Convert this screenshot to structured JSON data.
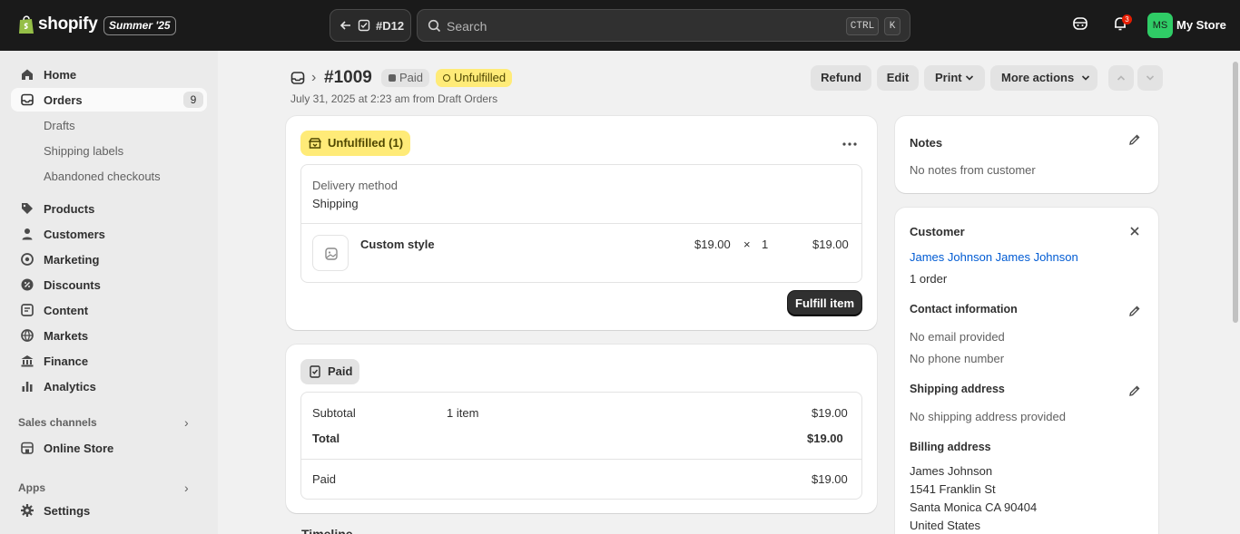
{
  "topbar": {
    "brand": "shopify",
    "edition": "Summer '25",
    "draft_tag": "#D12",
    "search_placeholder": "Search",
    "kbd_ctrl": "CTRL",
    "kbd_k": "K",
    "notification_count": "3",
    "avatar_initials": "MS",
    "store_name": "My Store"
  },
  "sidebar": {
    "home": "Home",
    "orders": "Orders",
    "orders_count": "9",
    "drafts": "Drafts",
    "shipping_labels": "Shipping labels",
    "abandoned": "Abandoned checkouts",
    "products": "Products",
    "customers": "Customers",
    "marketing": "Marketing",
    "discounts": "Discounts",
    "content": "Content",
    "markets": "Markets",
    "finance": "Finance",
    "analytics": "Analytics",
    "sales_channels": "Sales channels",
    "online_store": "Online Store",
    "apps": "Apps",
    "settings": "Settings"
  },
  "header": {
    "order_number": "#1009",
    "payment_badge": "Paid",
    "fulfillment_badge": "Unfulfilled",
    "subtitle": "July 31, 2025 at 2:23 am from Draft Orders",
    "refund": "Refund",
    "edit": "Edit",
    "print": "Print",
    "more_actions": "More actions"
  },
  "fulfillment_card": {
    "status": "Unfulfilled (1)",
    "delivery_label": "Delivery method",
    "delivery_value": "Shipping",
    "item_name": "Custom style",
    "item_price": "$19.00",
    "item_times": "×",
    "item_qty": "1",
    "item_total": "$19.00",
    "fulfill_button": "Fulfill item"
  },
  "payment_card": {
    "status": "Paid",
    "subtotal_label": "Subtotal",
    "subtotal_items": "1 item",
    "subtotal_value": "$19.00",
    "total_label": "Total",
    "total_value": "$19.00",
    "paid_label": "Paid",
    "paid_value": "$19.00",
    "timeline_partial": "Timeline"
  },
  "notes_card": {
    "title": "Notes",
    "text": "No notes from customer"
  },
  "customer_card": {
    "title": "Customer",
    "name": "James Johnson James Johnson",
    "orders": "1 order",
    "contact_title": "Contact information",
    "no_email": "No email provided",
    "no_phone": "No phone number",
    "shipping_title": "Shipping address",
    "no_shipping": "No shipping address provided",
    "billing_title": "Billing address",
    "billing_name": "James Johnson",
    "billing_street": "1541 Franklin St",
    "billing_city": "Santa Monica CA 90404",
    "billing_country": "United States"
  },
  "colors": {
    "topbar": "#1a1a1a",
    "unfulfilled_yellow": "#ffeb78",
    "link_blue": "#005bd3",
    "primary_button": "#303030",
    "avatar_green": "#2fcc66"
  }
}
